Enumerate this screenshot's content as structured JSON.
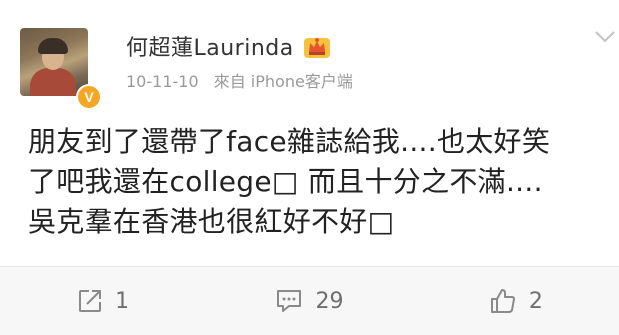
{
  "user": {
    "name": "何超蓮Laurinda",
    "verified_mark": "V",
    "badge_icon": "crown-icon"
  },
  "meta": {
    "date": "10-11-10",
    "source": "來自 iPhone客户端"
  },
  "post": {
    "lines": [
      "朋友到了還帶了face雜誌給我....也太好笑",
      "了吧我還在college□ 而且十分之不滿....",
      "吳克羣在香港也很紅好不好□"
    ]
  },
  "actions": {
    "repost_count": "1",
    "comment_count": "29",
    "like_count": "2"
  },
  "colors": {
    "accent": "#f5a623",
    "meta_text": "#9a9a9a",
    "action_bar_bg": "#f7f7f7"
  }
}
